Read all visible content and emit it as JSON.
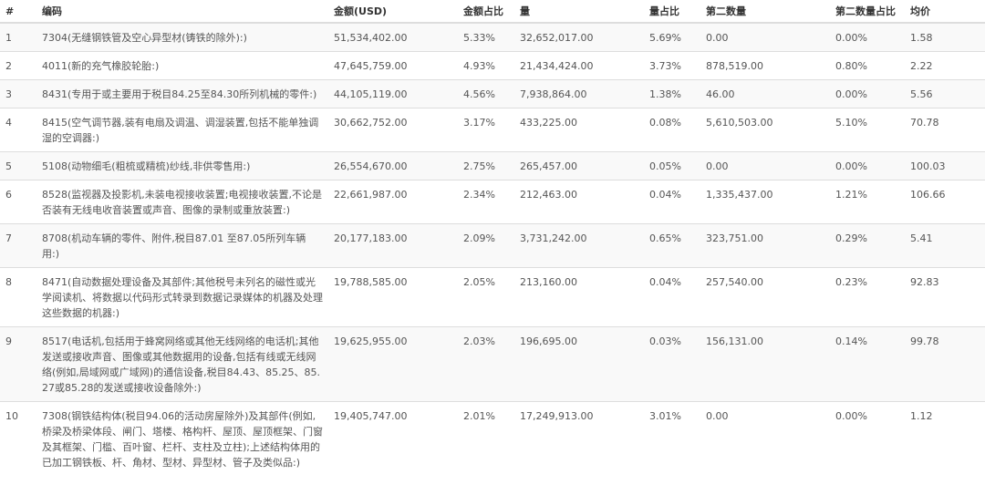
{
  "table": {
    "headers": [
      "#",
      "编码",
      "金额(USD)",
      "金额占比",
      "量",
      "量占比",
      "第二数量",
      "第二数量占比",
      "均价"
    ],
    "rows": [
      [
        "1",
        "7304(无缝钢铁管及空心异型材(铸铁的除外):)",
        "51,534,402.00",
        "5.33%",
        "32,652,017.00",
        "5.69%",
        "0.00",
        "0.00%",
        "1.58"
      ],
      [
        "2",
        "4011(新的充气橡胶轮胎:)",
        "47,645,759.00",
        "4.93%",
        "21,434,424.00",
        "3.73%",
        "878,519.00",
        "0.80%",
        "2.22"
      ],
      [
        "3",
        "8431(专用于或主要用于税目84.25至84.30所列机械的零件:)",
        "44,105,119.00",
        "4.56%",
        "7,938,864.00",
        "1.38%",
        "46.00",
        "0.00%",
        "5.56"
      ],
      [
        "4",
        "8415(空气调节器,装有电扇及调温、调湿装置,包括不能单独调湿的空调器:)",
        "30,662,752.00",
        "3.17%",
        "433,225.00",
        "0.08%",
        "5,610,503.00",
        "5.10%",
        "70.78"
      ],
      [
        "5",
        "5108(动物细毛(粗梳或精梳)纱线,非供零售用:)",
        "26,554,670.00",
        "2.75%",
        "265,457.00",
        "0.05%",
        "0.00",
        "0.00%",
        "100.03"
      ],
      [
        "6",
        "8528(监视器及投影机,未装电视接收装置;电视接收装置,不论是否装有无线电收音装置或声音、图像的录制或重放装置:)",
        "22,661,987.00",
        "2.34%",
        "212,463.00",
        "0.04%",
        "1,335,437.00",
        "1.21%",
        "106.66"
      ],
      [
        "7",
        "8708(机动车辆的零件、附件,税目87.01 至87.05所列车辆用:)",
        "20,177,183.00",
        "2.09%",
        "3,731,242.00",
        "0.65%",
        "323,751.00",
        "0.29%",
        "5.41"
      ],
      [
        "8",
        "8471(自动数据处理设备及其部件;其他税号未列名的磁性或光学阅读机、将数据以代码形式转录到数据记录媒体的机器及处理这些数据的机器:)",
        "19,788,585.00",
        "2.05%",
        "213,160.00",
        "0.04%",
        "257,540.00",
        "0.23%",
        "92.83"
      ],
      [
        "9",
        "8517(电话机,包括用于蜂窝网络或其他无线网络的电话机;其他发送或接收声音、图像或其他数据用的设备,包括有线或无线网络(例如,局域网或广域网)的通信设备,税目84.43、85.25、85.27或85.28的发送或接收设备除外:)",
        "19,625,955.00",
        "2.03%",
        "196,695.00",
        "0.03%",
        "156,131.00",
        "0.14%",
        "99.78"
      ],
      [
        "10",
        "7308(钢铁结构体(税目94.06的活动房屋除外)及其部件(例如,桥梁及桥梁体段、闸门、塔楼、格构杆、屋顶、屋顶框架、门窗及其框架、门槛、百叶窗、栏杆、支柱及立柱);上述结构体用的已加工钢铁板、杆、角材、型材、异型材、管子及类似品:)",
        "19,405,747.00",
        "2.01%",
        "17,249,913.00",
        "3.01%",
        "0.00",
        "0.00%",
        "1.12"
      ]
    ]
  }
}
